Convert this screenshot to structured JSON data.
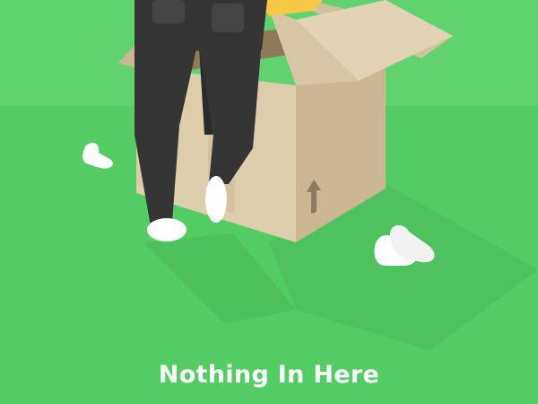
{
  "empty_state": {
    "title": "Nothing In Here",
    "illustration": "person-digging-in-cardboard-box",
    "icons": [
      "sneaker-icon",
      "sock-icon",
      "up-arrow-icon"
    ]
  },
  "colors": {
    "background": "#59d068",
    "box": "#d6c6a4",
    "pants": "#353535",
    "text": "#ffffff"
  }
}
